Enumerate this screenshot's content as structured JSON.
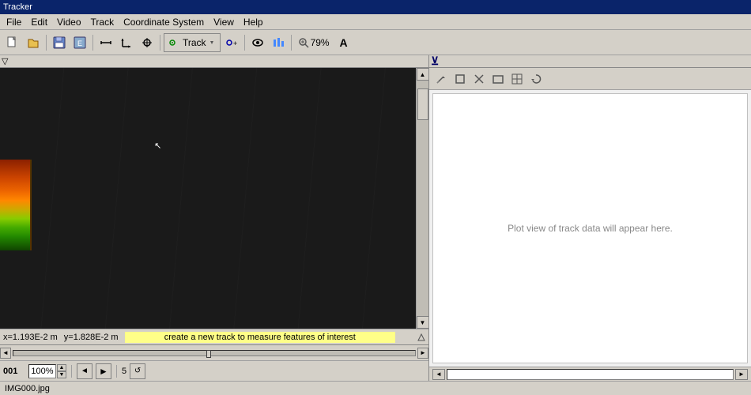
{
  "titleBar": {
    "label": "Tracker"
  },
  "menuBar": {
    "items": [
      "File",
      "Edit",
      "Video",
      "Track",
      "Coordinate System",
      "View",
      "Help"
    ]
  },
  "toolbar": {
    "trackButton": "Track",
    "zoomLevel": "79%"
  },
  "videoPanel": {
    "filterLabel": "▽",
    "coordsX": "x=1.193E-2 m",
    "coordsY": "y=1.828E-2 m",
    "trackHint": "create a new track to measure features of interest",
    "scrollUp": "▲",
    "scrollDown": "▼",
    "scrollRight": "►",
    "scrollLeft": "◄"
  },
  "controls": {
    "frameNumber": "001",
    "zoomPercent": "100%",
    "spinUp": "▲",
    "spinDown": "▼",
    "stepBack": "◄",
    "play": "►",
    "stepForward": "►|",
    "frameCount": "5"
  },
  "plotPanel": {
    "cornerIcon": "⊻",
    "placeholder": "Plot view of track data will appear here.",
    "toolbar": {
      "pencilIcon": "✏",
      "squareIcon": "□",
      "xIcon": "×",
      "plusIcon": "+",
      "gridIcon": "⊞",
      "refreshIcon": "↺"
    }
  },
  "plotBottom": {
    "leftBtn": "◄",
    "rightBtn": "►"
  },
  "filename": "IMG000.jpg"
}
